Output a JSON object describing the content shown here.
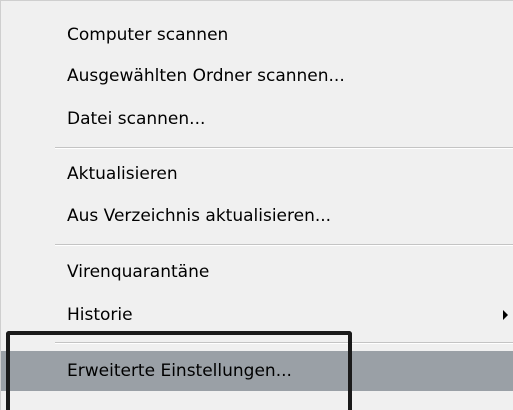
{
  "menu": {
    "items": [
      {
        "label": "Computer scannen"
      },
      {
        "label": "Ausgewählten Ordner scannen..."
      },
      {
        "label": "Datei scannen..."
      },
      {
        "label": "Aktualisieren"
      },
      {
        "label": "Aus Verzeichnis aktualisieren..."
      },
      {
        "label": "Virenquarantäne"
      },
      {
        "label": "Historie",
        "has_submenu": true
      },
      {
        "label": "Erweiterte Einstellungen...",
        "highlighted": true
      }
    ]
  },
  "colors": {
    "menu_background": "#f0f0f0",
    "highlight": "#9aa0a6",
    "focus_frame": "#1a1a1a"
  }
}
